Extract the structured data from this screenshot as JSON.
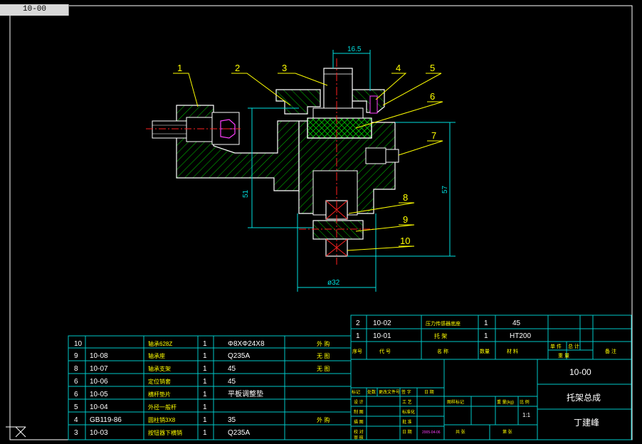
{
  "drawing_tab": "10-00",
  "dimensions": {
    "top_width": "16.5",
    "left_height": "51",
    "right_height": "57",
    "bottom_diameter": "ø32"
  },
  "callouts": [
    "1",
    "2",
    "3",
    "4",
    "5",
    "6",
    "7",
    "8",
    "9",
    "10"
  ],
  "bom_upper": [
    {
      "seq": "2",
      "code": "10-02",
      "name": "压力传感器底座",
      "qty": "1",
      "material": "45",
      "remark": ""
    },
    {
      "seq": "1",
      "code": "10-01",
      "name": "托 架",
      "qty": "1",
      "material": "HT200",
      "remark": ""
    }
  ],
  "bom_upper_headers": {
    "seq": "序号",
    "code": "代   号",
    "name": "名     称",
    "qty": "数量",
    "material": "材    料",
    "single": "单 件",
    "total": "总 计",
    "mass": "重    量",
    "remark": "备  注"
  },
  "bom_lower": [
    {
      "seq": "10",
      "code": "",
      "name": "轴承628Z",
      "qty": "1",
      "material": "Φ8XΦ24X8",
      "remark": "外 购"
    },
    {
      "seq": "9",
      "code": "10-08",
      "name": "轴承座",
      "qty": "1",
      "material": "Q235A",
      "remark": "无 图"
    },
    {
      "seq": "8",
      "code": "10-07",
      "name": "轴承支架",
      "qty": "1",
      "material": "45",
      "remark": "无 图"
    },
    {
      "seq": "6",
      "code": "10-06",
      "name": "定位销套",
      "qty": "1",
      "material": "45",
      "remark": ""
    },
    {
      "seq": "6",
      "code": "10-05",
      "name": "横杆垫片",
      "qty": "1",
      "material": "平板调整垫",
      "remark": ""
    },
    {
      "seq": "5",
      "code": "10-04",
      "name": "外径一般杆",
      "qty": "1",
      "material": "",
      "remark": ""
    },
    {
      "seq": "4",
      "code": "GB119-86",
      "name": "圆柱销3X8",
      "qty": "1",
      "material": "35",
      "remark": "外 购"
    },
    {
      "seq": "3",
      "code": "10-03",
      "name": "按钮器下横销",
      "qty": "1",
      "material": "Q235A",
      "remark": ""
    }
  ],
  "title_block": {
    "drawing_no": "10-00",
    "drawing_name": "托架总成",
    "author": "丁建峰",
    "scale": "1:1",
    "rev_header": [
      "标记",
      "处数",
      "更改文件号",
      "签 字",
      "日 期"
    ],
    "left_labels": [
      "设 计",
      "制 图",
      "描 图",
      "校 对",
      "审 核"
    ],
    "mid_labels": [
      "工 艺",
      "标准化",
      "批 准",
      "日 期"
    ],
    "stage_label": "图样标记",
    "weight_label": "重 量(kg)",
    "scale_label": "比 例",
    "sheet_total": "共   张",
    "sheet_no": "第   张",
    "date": "2005-04-06"
  },
  "colors": {
    "background": "#000000",
    "table_lines": "#00c8c8",
    "outline": "#ffffff",
    "hatch": "#00c800",
    "center_line": "#ff2020",
    "dimension": "#00e0e0",
    "leader": "#ffff00",
    "table_text": "#ffffff",
    "table_text_yellow": "#ffff00",
    "nut": "#ff40ff",
    "frame": "#ffffff"
  }
}
